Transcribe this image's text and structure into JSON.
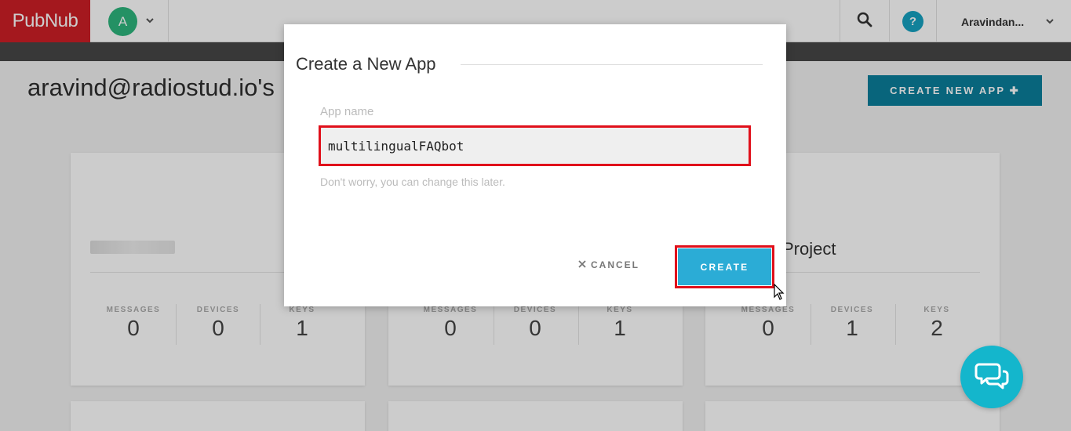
{
  "nav": {
    "logo": "PubNub",
    "avatar_initial": "A",
    "user_name": "Aravindan...",
    "icons": [
      "chevron-down-icon",
      "search-icon",
      "help-icon"
    ]
  },
  "page": {
    "title": "aravind@radiostud.io's",
    "create_new_app_label": "CREATE NEW APP ✚"
  },
  "cards": [
    {
      "title": "",
      "stats": [
        {
          "label": "MESSAGES",
          "value": "0"
        },
        {
          "label": "DEVICES",
          "value": "0"
        },
        {
          "label": "KEYS",
          "value": "1"
        }
      ]
    },
    {
      "title": "",
      "stats": [
        {
          "label": "MESSAGES",
          "value": "0"
        },
        {
          "label": "DEVICES",
          "value": "0"
        },
        {
          "label": "KEYS",
          "value": "1"
        }
      ]
    },
    {
      "title": "Project",
      "stats": [
        {
          "label": "MESSAGES",
          "value": "0"
        },
        {
          "label": "DEVICES",
          "value": "1"
        },
        {
          "label": "KEYS",
          "value": "2"
        }
      ]
    }
  ],
  "modal": {
    "title": "Create a New App",
    "field_label": "App name",
    "field_value": "multilingualFAQbot",
    "field_hint": "Don't worry, you can change this later.",
    "cancel_label": "CANCEL",
    "create_label": "CREATE"
  },
  "colors": {
    "brand_red": "#ce1f26",
    "primary_button": "#0a7f9c",
    "create_button": "#2bacd6",
    "highlight_red": "#e0101b",
    "avatar_green": "#2eb67d",
    "chat_fab": "#14b6cc"
  }
}
